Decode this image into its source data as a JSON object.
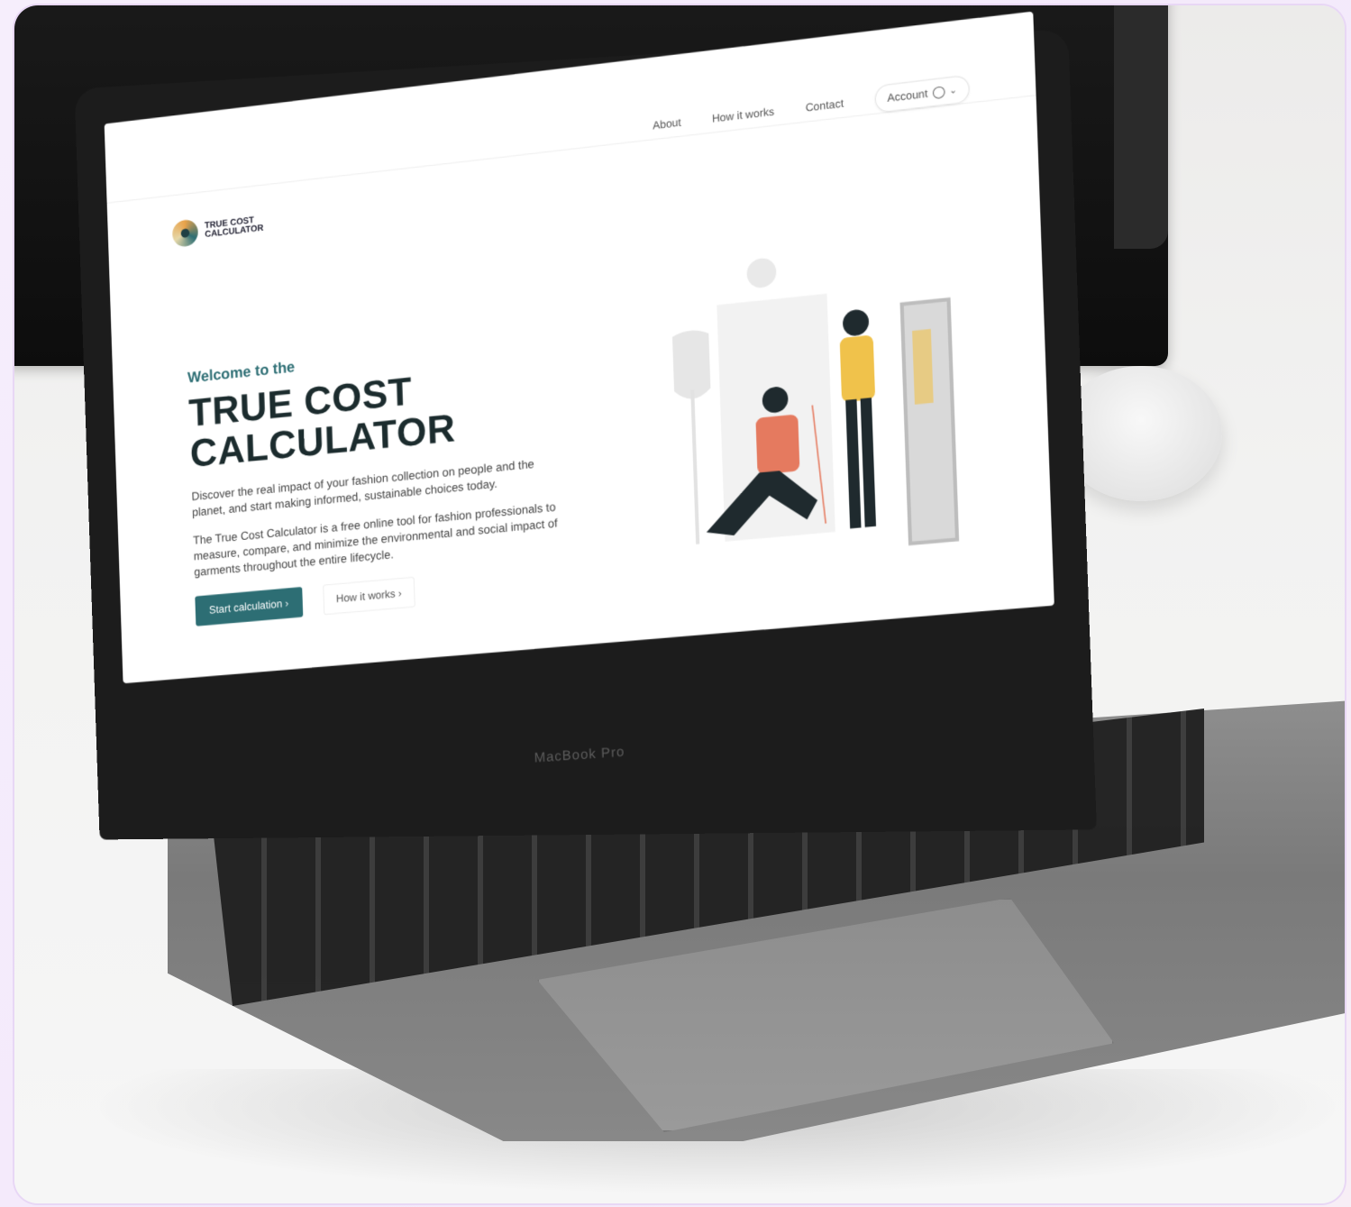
{
  "laptop": {
    "brand_label": "MacBook Pro"
  },
  "site": {
    "logo_text": "TRUE COST CALCULATOR",
    "nav": {
      "about": "About",
      "how_it_works": "How it works",
      "contact": "Contact",
      "account": "Account",
      "account_icons": [
        "globe-icon",
        "chevron-down-icon"
      ]
    },
    "hero": {
      "welcome": "Welcome to the",
      "title": "TRUE COST CALCULATOR",
      "intro": "Discover the real impact of your fashion collection on people and the planet, and start making informed, sustainable choices today.",
      "description": "The True Cost Calculator is a free online tool for fashion professionals to measure, compare, and minimize the environmental and social impact of garments throughout the entire lifecycle.",
      "primary_cta": "Start calculation ›",
      "secondary_cta": "How it works ›"
    },
    "colors": {
      "accent": "#2d6e74",
      "title": "#1c2c2e",
      "illustration_shirt": "#e57a5f",
      "illustration_top": "#f0c24b"
    }
  }
}
